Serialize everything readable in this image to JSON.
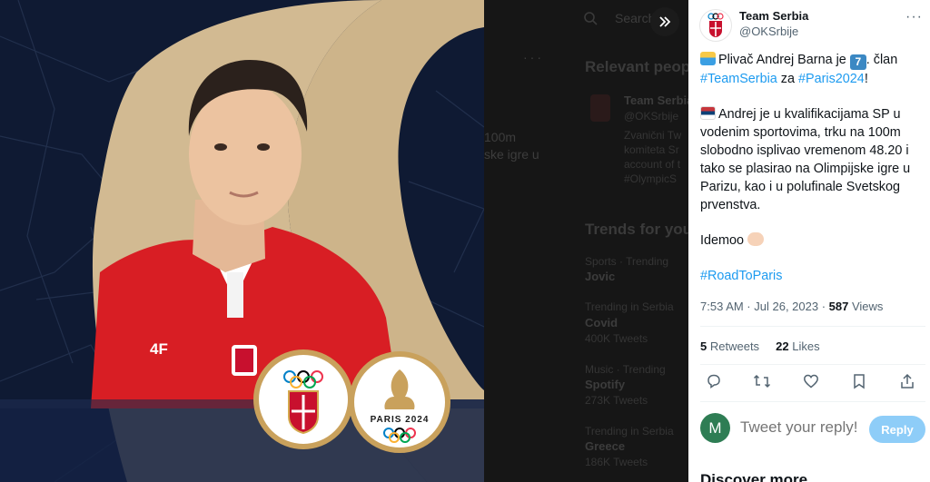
{
  "media": {
    "badge_text": "PARIS 2024",
    "expand_icon": "chevrons-right-icon"
  },
  "backdrop": {
    "search_placeholder": "Search",
    "relevant_heading": "Relevant people",
    "person_name": "Team Serbia",
    "person_handle": "@OKSrbije",
    "person_bio": [
      "Zvanični Tw",
      "komiteta Sr",
      "account of t",
      "#OlympicS"
    ],
    "partial_text_1": "100m",
    "partial_text_2": "ske igre u",
    "trends_heading": "Trends for you",
    "trends": [
      {
        "category": "Sports · Trending",
        "name": "Jovic",
        "count": ""
      },
      {
        "category": "Trending in Serbia",
        "name": "Covid",
        "count": "400K Tweets"
      },
      {
        "category": "Music · Trending",
        "name": "Spotify",
        "count": "273K Tweets"
      },
      {
        "category": "Trending in Serbia",
        "name": "Greece",
        "count": "186K Tweets"
      }
    ]
  },
  "tweet": {
    "display_name": "Team Serbia",
    "handle": "@OKSrbije",
    "more_icon": "more-horizontal-icon",
    "line1_pre": "Plivač Andrej Barna je",
    "keycap": "7",
    "line1_post": ". član",
    "hashtag_team": "#TeamSerbia",
    "za": "za",
    "hashtag_paris": "#Paris2024",
    "exclaim": "!",
    "paragraph2": "Andrej je u kvalifikacijama SP u vodenim sportovima, trku na 100m slobodno isplivao vremenom 48.20 i tako se plasirao na Olimpijske igre u Parizu, kao i u polufinale Svetskog prvenstva.",
    "paragraph3": "Idemoo",
    "hashtag_road": "#RoadToParis",
    "time": "7:53 AM · Jul 26, 2023 · ",
    "views_count": "587",
    "views_label": " Views",
    "retweets_count": "5",
    "retweets_label": "Retweets",
    "likes_count": "22",
    "likes_label": "Likes"
  },
  "reply": {
    "avatar_letter": "M",
    "placeholder": "Tweet your reply!",
    "button_label": "Reply"
  },
  "discover_heading": "Discover more",
  "colors": {
    "accent": "#1d9bf0",
    "reply_button": "#8ecdf8",
    "reply_avatar": "#2e7d54",
    "jersey_red": "#d81e24",
    "gold": "#c9a15c"
  }
}
